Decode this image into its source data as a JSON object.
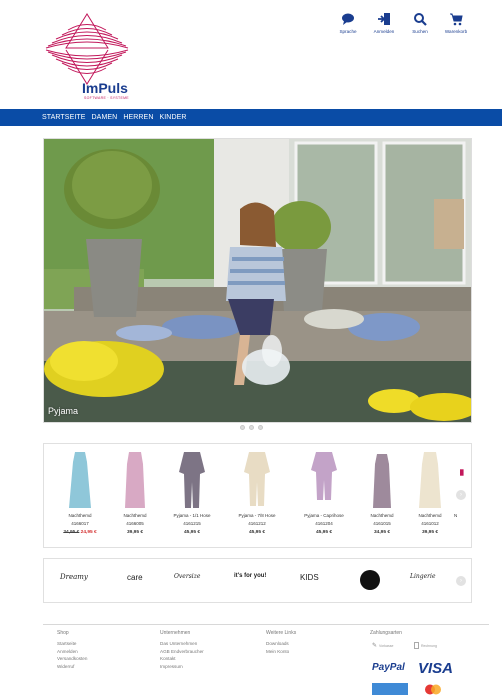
{
  "header": {
    "logo_text": "ImPuls",
    "logo_subtext": "SOFTWARE · SYSTEME",
    "tools": [
      {
        "label": "Sprache",
        "icon": "speech-bubble-icon"
      },
      {
        "label": "Anmelden",
        "icon": "login-icon"
      },
      {
        "label": "Suchen",
        "icon": "search-icon"
      },
      {
        "label": "Warenkorb",
        "icon": "cart-icon"
      }
    ]
  },
  "nav": {
    "items": [
      "STARTSEITE",
      "DAMEN",
      "HERREN",
      "KINDER"
    ]
  },
  "hero": {
    "label": "Pyjama"
  },
  "products": [
    {
      "name": "Nachthemd",
      "number": "4166017",
      "old_price": "34,95 €",
      "price": "24,95 €",
      "color": "#8fc7d9"
    },
    {
      "name": "Nachthemd",
      "number": "4166005",
      "price": "39,95 €",
      "color": "#d8a9c4"
    },
    {
      "name": "Pyjama - 1/1 Hose",
      "number": "4161215",
      "price": "45,95 €",
      "color": "#7d7485"
    },
    {
      "name": "Pyjama - 7/8 Hose",
      "number": "4161212",
      "price": "45,95 €",
      "color": "#e8dcc4"
    },
    {
      "name": "Pyjama - Caprihose",
      "number": "4161204",
      "price": "45,95 €",
      "color": "#c3a3c8"
    },
    {
      "name": "Nachthemd",
      "number": "4161015",
      "price": "34,95 €",
      "color": "#9e8a9c"
    },
    {
      "name": "Nachthemd",
      "number": "4161012",
      "price": "39,95 €",
      "color": "#ede4cf"
    },
    {
      "name": "N",
      "number": "",
      "price": "",
      "color": "#c2185b"
    }
  ],
  "brands": {
    "items": [
      "Dreamy",
      "care",
      "Oversize",
      "it's for you!",
      "KIDS",
      "Lingerie"
    ]
  },
  "footer": {
    "columns": [
      {
        "heading": "Shop",
        "links": [
          "Startseite",
          "Anmelden",
          "Versandkosten",
          "Widerruf"
        ]
      },
      {
        "heading": "Unternehmen",
        "links": [
          "Das Unternehmen",
          "AGB Endverbraucher",
          "Kontakt",
          "Impressum"
        ]
      },
      {
        "heading": "Weitere Links",
        "links": [
          "Downloads",
          "Mein Konto"
        ]
      },
      {
        "heading": "Zahlungsarten",
        "links": []
      }
    ],
    "payment": {
      "vorkasse": "Vorkasse",
      "rechnung": "Rechnung",
      "paypal": "PayPal",
      "visa": "VISA"
    }
  }
}
